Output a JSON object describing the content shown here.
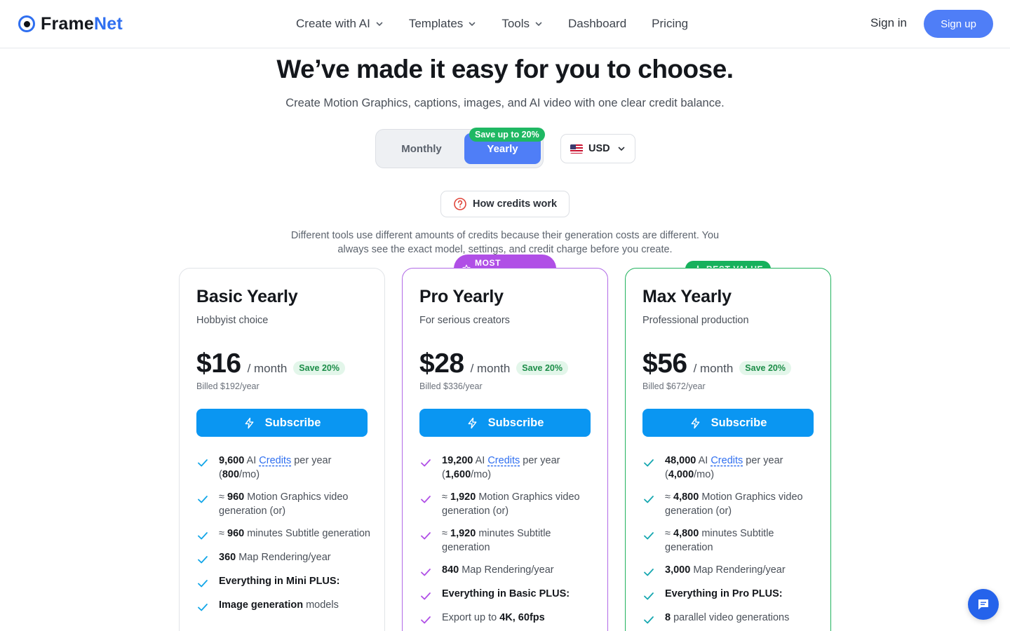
{
  "brand": {
    "name_part1": "Frame",
    "name_part2": "Net",
    "accent_color": "#2f6ff0"
  },
  "nav": {
    "links": [
      {
        "label": "Create with AI",
        "has_dropdown": true
      },
      {
        "label": "Templates",
        "has_dropdown": true
      },
      {
        "label": "Tools",
        "has_dropdown": true
      },
      {
        "label": "Dashboard",
        "has_dropdown": false
      },
      {
        "label": "Pricing",
        "has_dropdown": false
      }
    ],
    "signin": "Sign in",
    "signup": "Sign up"
  },
  "hero": {
    "title": "We’ve made it easy for you to choose.",
    "subtitle": "Create Motion Graphics, captions, images, and AI video with one clear credit balance."
  },
  "billing_toggle": {
    "monthly": "Monthly",
    "yearly": "Yearly",
    "selected": "Yearly",
    "save_badge": "Save up to 20%"
  },
  "currency": {
    "code": "USD",
    "flag_icon": "us-flag-icon"
  },
  "how_credits": {
    "label": "How credits work",
    "icon": "question-circle-icon"
  },
  "explanation": "Different tools use different amounts of credits because their generation costs are different. You always see the exact model, settings, and credit charge before you create.",
  "plans": [
    {
      "title": "Basic Yearly",
      "subtitle": "Hobbyist choice",
      "price": "$16",
      "per": "/ month",
      "save": "Save 20%",
      "billed": "Billed $192/year",
      "button": "Subscribe",
      "check_color": "#12a6e8",
      "features": {
        "f1": {
          "b1": "9,600",
          "t1": " AI ",
          "link": "Credits",
          "t2": " per year (",
          "b2": "800",
          "t3": "/mo)"
        },
        "f2": {
          "t1": "≈ ",
          "b1": "960",
          "t2": " Motion Graphics video generation (or)"
        },
        "f3": {
          "t1": "≈ ",
          "b1": "960",
          "t2": " minutes Subtitle generation"
        },
        "f4": {
          "b1": "360",
          "t1": " Map Rendering/year"
        },
        "f5": {
          "b1": "Everything in Mini PLUS:"
        },
        "f6": {
          "b1": "Image generation",
          "t1": " models"
        }
      }
    },
    {
      "title": "Pro Yearly",
      "subtitle": "For serious creators",
      "price": "$28",
      "per": "/ month",
      "save": "Save 20%",
      "billed": "Billed $336/year",
      "button": "Subscribe",
      "badge": "MOST POPULAR",
      "check_color": "#b04fe6",
      "features": {
        "f1": {
          "b1": "19,200",
          "t1": " AI ",
          "link": "Credits",
          "t2": " per year (",
          "b2": "1,600",
          "t3": "/mo)"
        },
        "f2": {
          "t1": "≈ ",
          "b1": "1,920",
          "t2": " Motion Graphics video generation (or)"
        },
        "f3": {
          "t1": "≈ ",
          "b1": "1,920",
          "t2": " minutes Subtitle generation"
        },
        "f4": {
          "b1": "840",
          "t1": " Map Rendering/year"
        },
        "f5": {
          "b1": "Everything in Basic PLUS:"
        },
        "f6": {
          "t1": "Export up to ",
          "b1": "4K, 60fps"
        }
      }
    },
    {
      "title": "Max Yearly",
      "subtitle": "Professional production",
      "price": "$56",
      "per": "/ month",
      "save": "Save 20%",
      "billed": "Billed $672/year",
      "button": "Subscribe",
      "badge": "BEST VALUE",
      "check_color": "#16a7b0",
      "features": {
        "f1": {
          "b1": "48,000",
          "t1": " AI ",
          "link": "Credits",
          "t2": " per year (",
          "b2": "4,000",
          "t3": "/mo)"
        },
        "f2": {
          "t1": "≈ ",
          "b1": "4,800",
          "t2": " Motion Graphics video generation (or)"
        },
        "f3": {
          "t1": "≈ ",
          "b1": "4,800",
          "t2": " minutes Subtitle generation"
        },
        "f4": {
          "b1": "3,000",
          "t1": " Map Rendering/year"
        },
        "f5": {
          "b1": "Everything in Pro PLUS:"
        },
        "f6": {
          "b1": "8",
          "t1": " parallel video generations"
        }
      }
    }
  ],
  "chat": {
    "icon": "chat-icon"
  }
}
